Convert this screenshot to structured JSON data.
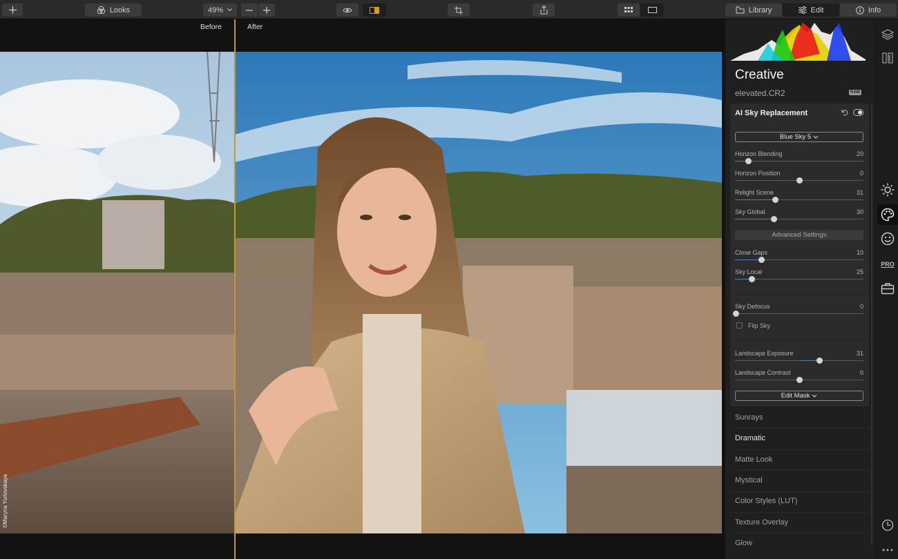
{
  "toolbar": {
    "looks_label": "Looks",
    "zoom": "49%",
    "library_label": "Library",
    "edit_label": "Edit",
    "info_label": "Info"
  },
  "compare": {
    "before": "Before",
    "after": "After"
  },
  "watermark": "©Maryna Yurlovskaya",
  "panel": {
    "section_title": "Creative",
    "filename": "elevated.CR2",
    "raw_badge": "RAW",
    "tool": {
      "title": "AI Sky Replacement",
      "sky_select": "Blue Sky 5",
      "advanced_label": "Advanced Settings",
      "flip_sky_label": "Flip Sky",
      "edit_mask_label": "Edit Mask",
      "sliders": {
        "horizon_blending": {
          "label": "Horizon Blending",
          "value": "20"
        },
        "horizon_position": {
          "label": "Horizon Position",
          "value": "0"
        },
        "relight_scene": {
          "label": "Relight Scene",
          "value": "31"
        },
        "sky_global": {
          "label": "Sky Global",
          "value": "30"
        },
        "close_gaps": {
          "label": "Close Gaps",
          "value": "10"
        },
        "sky_local": {
          "label": "Sky Local",
          "value": "25"
        },
        "sky_defocus": {
          "label": "Sky Defocus",
          "value": "0"
        },
        "landscape_exposure": {
          "label": "Landscape Exposure",
          "value": "31"
        },
        "landscape_contrast": {
          "label": "Landscape Contrast",
          "value": "0"
        }
      }
    },
    "tools_list": [
      "Sunrays",
      "Dramatic",
      "Matte Look",
      "Mystical",
      "Color Styles (LUT)",
      "Texture Overlay",
      "Glow"
    ]
  },
  "right_bar": {
    "pro_label": "PRO"
  }
}
